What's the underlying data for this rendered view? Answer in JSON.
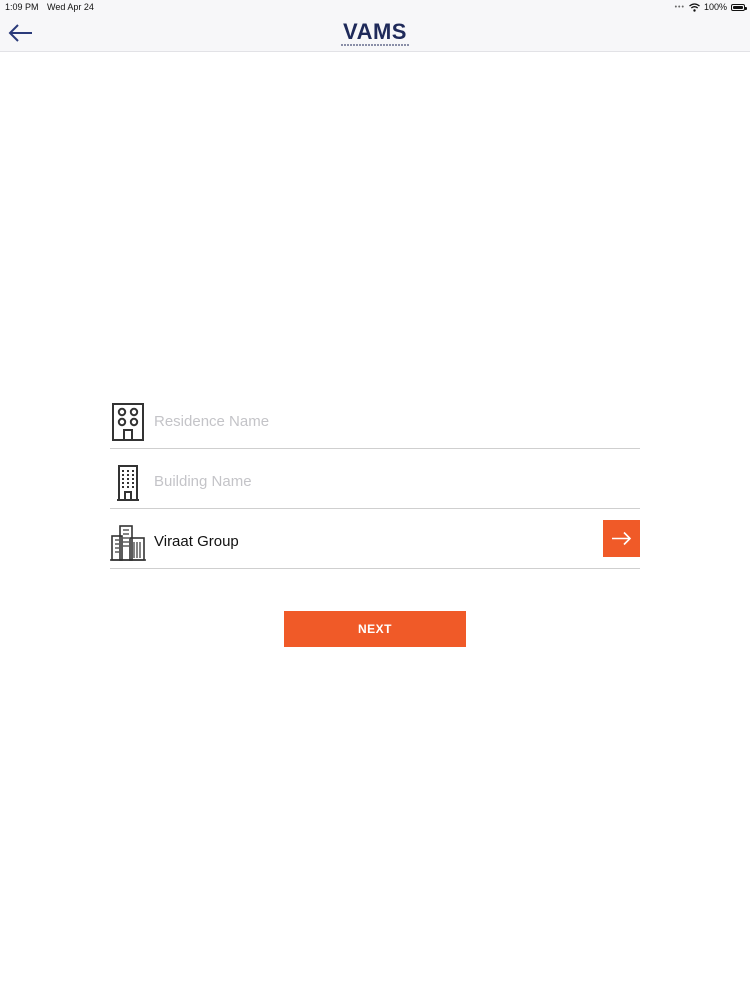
{
  "status_bar": {
    "time": "1:09 PM",
    "date": "Wed Apr 24",
    "battery": "100%",
    "battery_level": 1.0,
    "signal_icon": "wifi-icon"
  },
  "nav": {
    "back_icon": "arrow-left-icon",
    "logo_text": "VAMS",
    "accent_color": "#1f2a5a"
  },
  "form": {
    "residence": {
      "icon": "residence-building-icon",
      "placeholder": "Residence Name",
      "value": ""
    },
    "building": {
      "icon": "tower-building-icon",
      "placeholder": "Building Name",
      "value": ""
    },
    "group": {
      "icon": "city-buildings-icon",
      "placeholder": "",
      "value": "Viraat Group",
      "go_icon": "arrow-right-icon"
    }
  },
  "next_button": {
    "label": "NEXT",
    "color": "#f05a28"
  }
}
